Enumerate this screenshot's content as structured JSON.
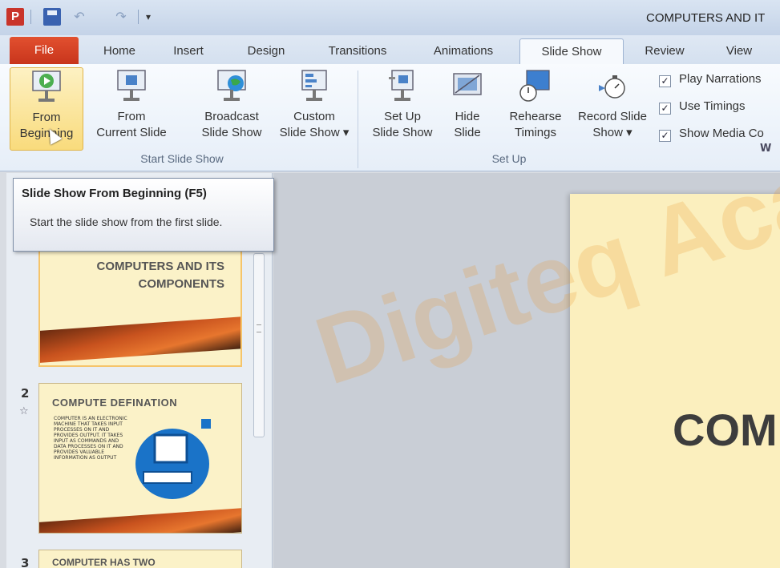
{
  "window": {
    "title": "COMPUTERS AND IT"
  },
  "quick_access": {
    "app_icon": "P"
  },
  "tabs": {
    "file": "File",
    "home": "Home",
    "insert": "Insert",
    "design": "Design",
    "transitions": "Transitions",
    "animations": "Animations",
    "slideshow": "Slide Show",
    "review": "Review",
    "view": "View"
  },
  "ribbon": {
    "start_group": {
      "label": "Start Slide Show",
      "from_beginning": [
        "From",
        "Beginning"
      ],
      "from_current": [
        "From",
        "Current Slide"
      ],
      "broadcast": [
        "Broadcast",
        "Slide Show"
      ],
      "custom": [
        "Custom",
        "Slide Show ▾"
      ]
    },
    "setup_group": {
      "label": "Set Up",
      "setup": [
        "Set Up",
        "Slide Show"
      ],
      "hide": [
        "Hide",
        "Slide"
      ],
      "rehearse": [
        "Rehearse",
        "Timings"
      ],
      "record": [
        "Record Slide",
        "Show ▾"
      ]
    },
    "checkboxes": {
      "play_narrations": "Play Narrations",
      "use_timings": "Use Timings",
      "show_media": "Show Media Co"
    },
    "check_mark": "✓",
    "watermark_small": "W"
  },
  "tooltip": {
    "title": "Slide Show From Beginning (F5)",
    "body": "Start the slide show from the first slide."
  },
  "slides": {
    "slide1_title": "COMPUTERS AND ITS COMPONENTS",
    "slide2_number": "2",
    "slide2_title": "COMPUTE DEFINATION",
    "slide2_bullets": "COMPUTER IS AN ELECTRONIC MACHINE THAT TAKES INPUT PROCESSES ON IT AND PROVIDES OUTPUT. IT TAKES INPUT AS COMMANDS AND DATA PROCESSES ON IT AND PROVIDES VALUABLE INFORMATION AS OUTPUT",
    "slide3_number": "3",
    "slide3_title": "COMPUTER HAS TWO",
    "star": "☆"
  },
  "editor": {
    "main_title": "COM"
  },
  "watermark": "Digiteq Acade",
  "colors": {
    "file_tab": "#d2401f",
    "accent": "#f5c46a",
    "slide_bg": "#fbefbe"
  }
}
